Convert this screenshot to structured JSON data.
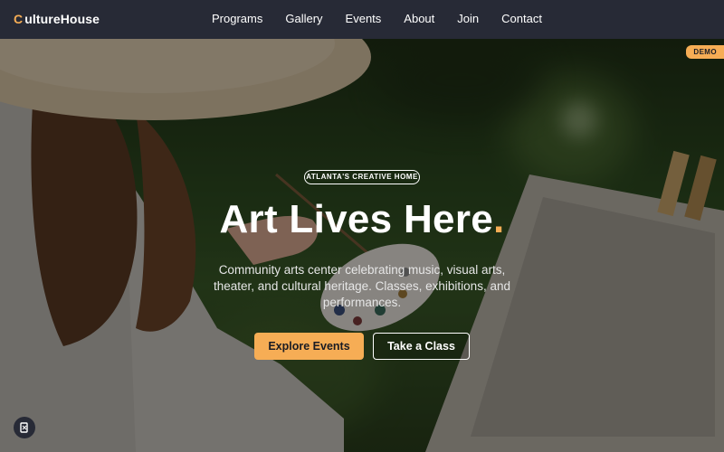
{
  "nav": {
    "logo_mark": "C",
    "logo_text": "ultureHouse",
    "links": [
      "Programs",
      "Gallery",
      "Events",
      "About",
      "Join",
      "Contact"
    ]
  },
  "hero": {
    "badge": "DEMO",
    "eyebrow": "ATLANTA'S CREATIVE HOME",
    "headline": "Art Lives Here",
    "headline_dot": ".",
    "subtext": "Community arts center celebrating music, visual arts, theater, and cultural heritage. Classes, exhibitions, and performances.",
    "primary_button": "Explore Events",
    "secondary_button": "Take a Class"
  },
  "colors": {
    "accent": "#f6ad55",
    "nav_bg": "#272a36"
  },
  "icons": {
    "floating": "accessibility-icon"
  }
}
